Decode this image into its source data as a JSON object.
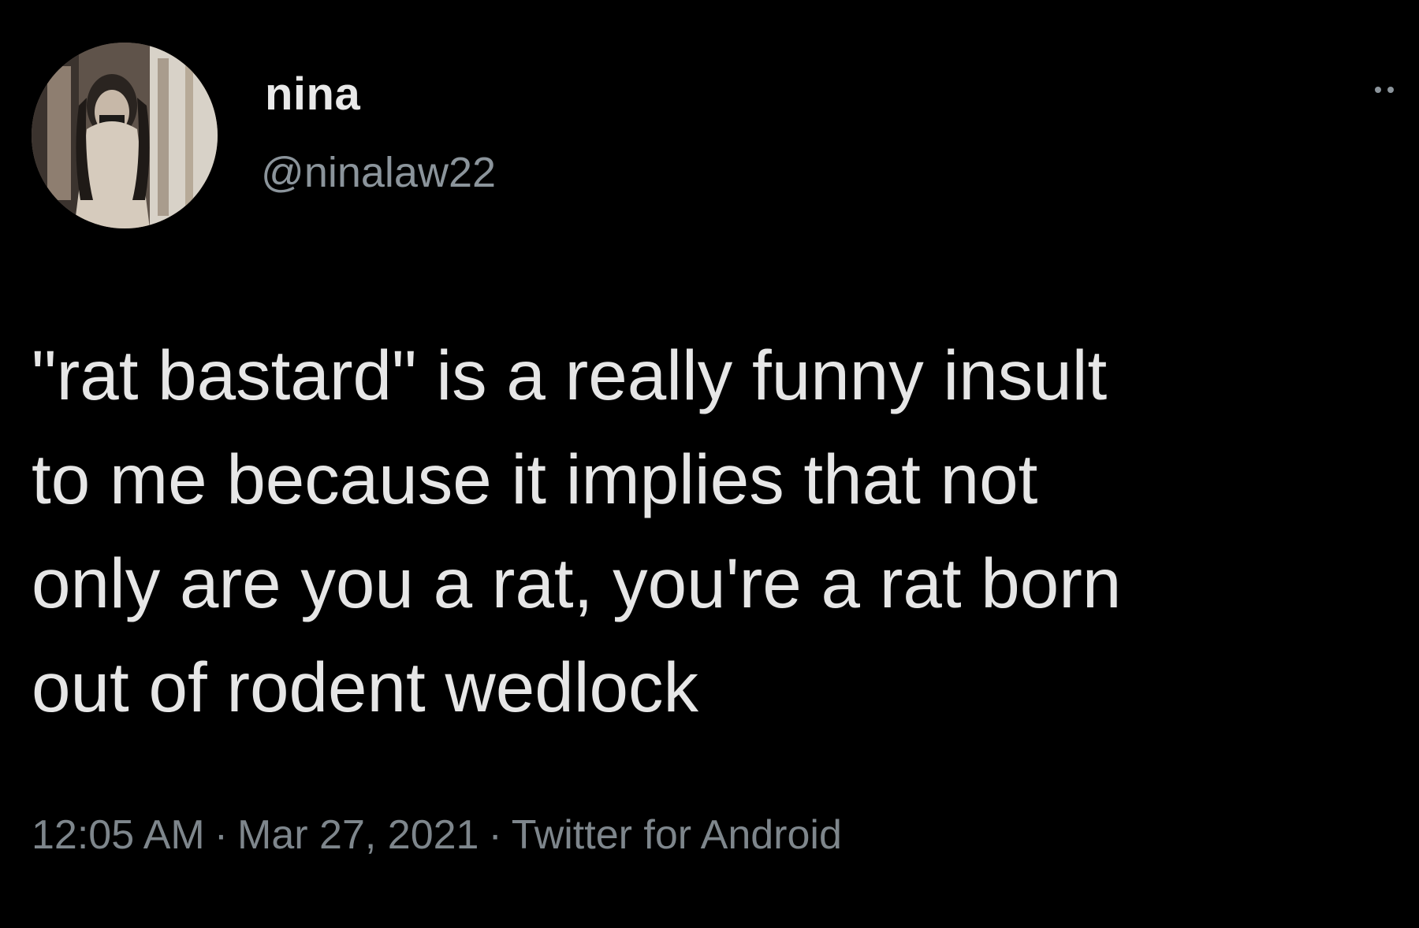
{
  "tweet": {
    "author": {
      "display_name": "nina",
      "handle": "@ninalaw22",
      "avatar_icon": "profile-photo"
    },
    "more_icon": "more-options-icon",
    "text": "\"rat bastard\" is a really funny insult\nto me because it implies that not\nonly are you a rat, you're a rat born\nout of rodent wedlock",
    "time": "12:05 AM",
    "separator": "·",
    "date": "Mar 27, 2021",
    "source": "Twitter for Android"
  },
  "colors": {
    "background": "#000000",
    "primary_text": "#e6e6e6",
    "secondary_text": "#8b949b"
  }
}
